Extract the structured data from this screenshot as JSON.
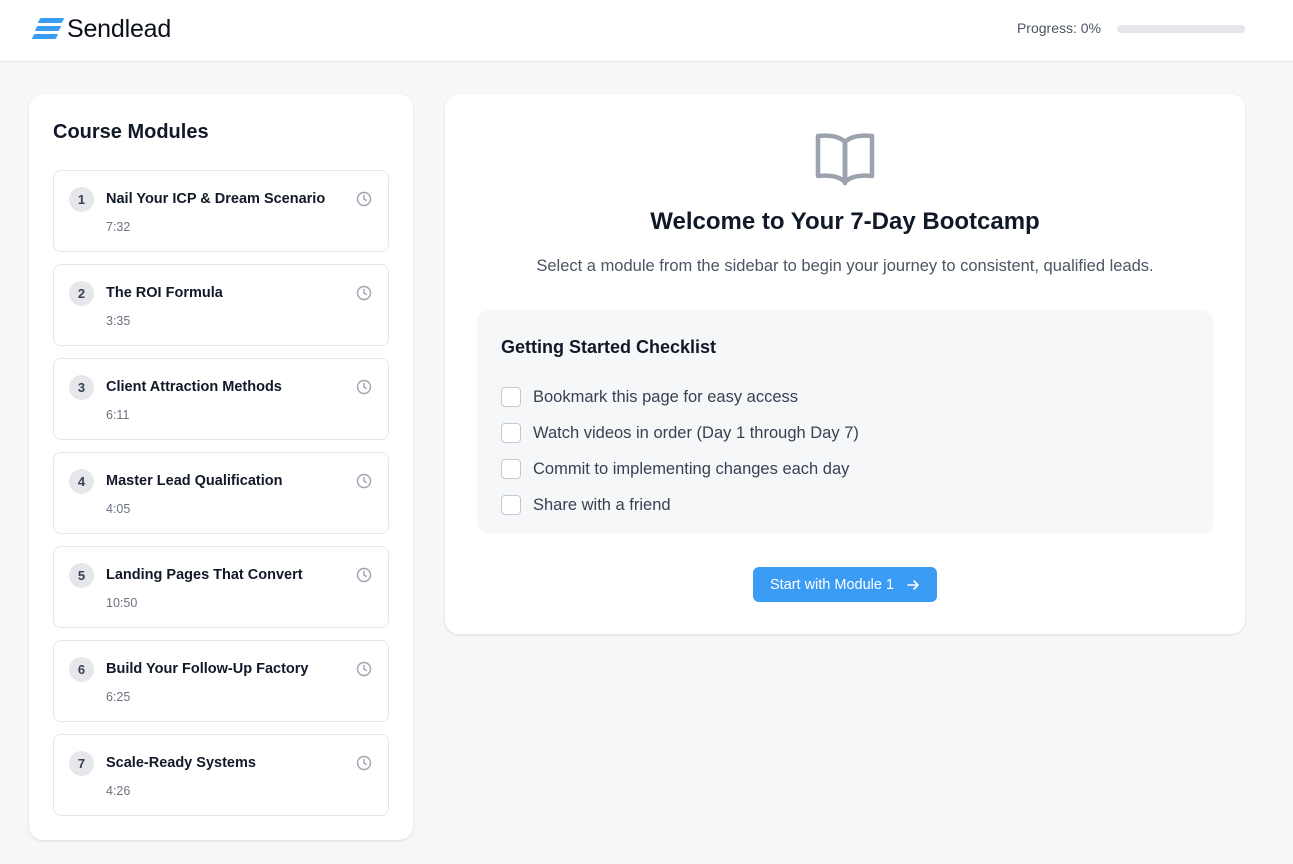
{
  "brand": {
    "name": "Sendlead",
    "accent": "#3b9cf5",
    "logo_icon": "stacked-bars-logo-icon"
  },
  "progress": {
    "label": "Progress: 0%",
    "value_percent": 0
  },
  "sidebar": {
    "title": "Course Modules",
    "modules": [
      {
        "number": "1",
        "title": "Nail Your ICP & Dream Scenario",
        "duration": "7:32",
        "icon": "clock-icon"
      },
      {
        "number": "2",
        "title": "The ROI Formula",
        "duration": "3:35",
        "icon": "clock-icon"
      },
      {
        "number": "3",
        "title": "Client Attraction Methods",
        "duration": "6:11",
        "icon": "clock-icon"
      },
      {
        "number": "4",
        "title": "Master Lead Qualification",
        "duration": "4:05",
        "icon": "clock-icon"
      },
      {
        "number": "5",
        "title": "Landing Pages That Convert",
        "duration": "10:50",
        "icon": "clock-icon"
      },
      {
        "number": "6",
        "title": "Build Your Follow-Up Factory",
        "duration": "6:25",
        "icon": "clock-icon"
      },
      {
        "number": "7",
        "title": "Scale-Ready Systems",
        "duration": "4:26",
        "icon": "clock-icon"
      }
    ]
  },
  "main": {
    "icon": "open-book-icon",
    "title": "Welcome to Your 7-Day Bootcamp",
    "subtitle": "Select a module from the sidebar to begin your journey to consistent, qualified leads.",
    "checklist": {
      "title": "Getting Started Checklist",
      "items": [
        {
          "label": "Bookmark this page for easy access",
          "checked": false
        },
        {
          "label": "Watch videos in order (Day 1 through Day 7)",
          "checked": false
        },
        {
          "label": "Commit to implementing changes each day",
          "checked": false
        },
        {
          "label": "Share with a friend",
          "checked": false
        }
      ]
    },
    "cta": {
      "label": "Start with Module 1",
      "icon": "arrow-right-icon"
    }
  }
}
